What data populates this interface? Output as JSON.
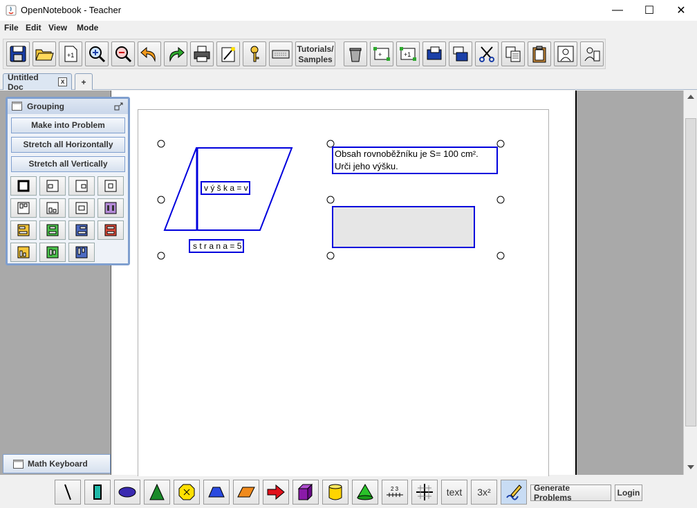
{
  "window": {
    "title": "OpenNotebook - Teacher",
    "minimize": "—",
    "maximize": "☐",
    "close": "✕"
  },
  "menu": {
    "items": [
      "File",
      "Edit",
      "View",
      "Mode"
    ]
  },
  "toolbar": {
    "tutorials_line1": "Tutorials/",
    "tutorials_line2": "Samples",
    "icons": [
      "save-icon",
      "open-folder-icon",
      "add-page-icon",
      "zoom-in-icon",
      "zoom-out-icon",
      "undo-icon",
      "redo-icon",
      "print-icon",
      "magic-wand-icon",
      "key-icon",
      "keyboard-icon",
      "trash-icon",
      "group-icon",
      "ungroup-icon",
      "send-back-icon",
      "bring-front-icon",
      "cut-icon",
      "copy-icon",
      "paste-icon",
      "student-icon",
      "teacher-icon"
    ]
  },
  "tabs": {
    "doc_label": "Untitled Doc",
    "close_label": "x",
    "add_label": "+"
  },
  "grouping": {
    "title": "Grouping",
    "make_problem": "Make into Problem",
    "stretch_h": "Stretch all Horizontally",
    "stretch_v": "Stretch all Vertically"
  },
  "math_keyboard": "Math Keyboard",
  "canvas": {
    "vyska_label": "v ý š k a = v",
    "strana_label": "s t r a n a = 5",
    "text_line1": "Obsah rovnoběžníku je S= 100 cm².",
    "text_line2": "Urči jeho výšku."
  },
  "bottom": {
    "text_btn": "text",
    "poly_btn": "3x²",
    "numline_btn": "2 3",
    "generate": "Generate Problems",
    "login": "Login"
  },
  "colors": {
    "accent": "#7f9fcf",
    "shape_blue": "#0000dd",
    "canvas_gray": "#a9a9a9"
  }
}
